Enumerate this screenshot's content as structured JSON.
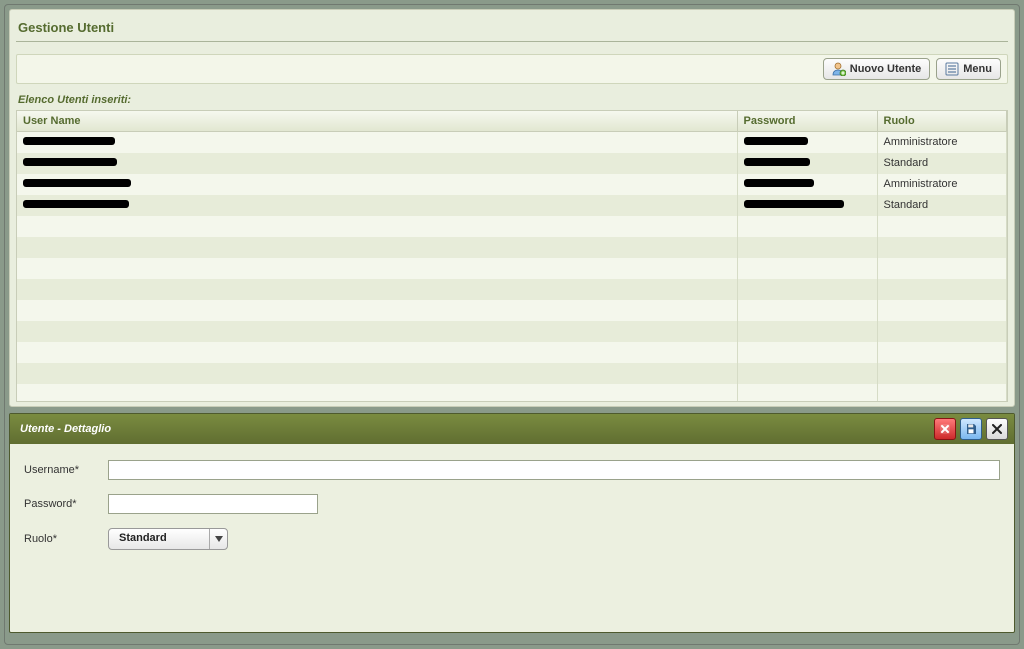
{
  "page": {
    "title": "Gestione Utenti",
    "list_caption": "Elenco Utenti inseriti:"
  },
  "toolbar": {
    "new_user_label": "Nuovo Utente",
    "menu_label": "Menu"
  },
  "table": {
    "columns": {
      "username": "User Name",
      "password": "Password",
      "role": "Ruolo"
    },
    "rows": [
      {
        "role": "Amministratore"
      },
      {
        "role": "Standard"
      },
      {
        "role": "Amministratore"
      },
      {
        "role": "Standard"
      }
    ]
  },
  "detail": {
    "title": "Utente - Dettaglio",
    "labels": {
      "username": "Username*",
      "password": "Password*",
      "role": "Ruolo*"
    },
    "values": {
      "username": "",
      "password": "",
      "role": "Standard"
    }
  }
}
